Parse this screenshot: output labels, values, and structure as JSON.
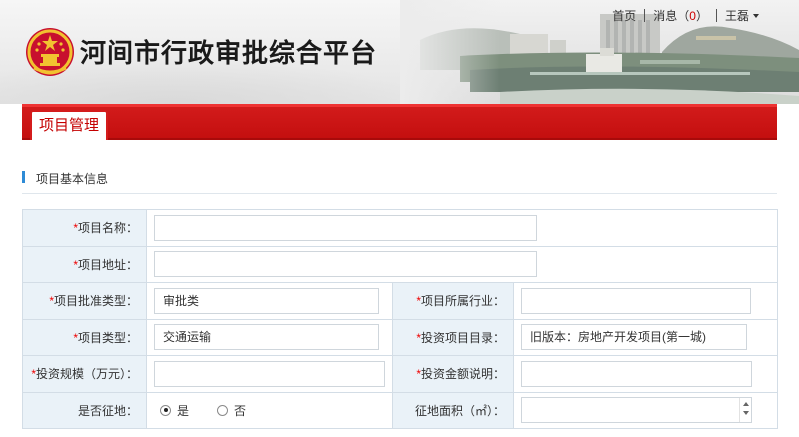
{
  "header": {
    "site_title": "河间市行政审批综合平台",
    "nav": {
      "home": "首页",
      "messages_label": "消息",
      "messages_open": "（",
      "messages_count": "0",
      "messages_close": "）",
      "user": "王磊"
    }
  },
  "tab": {
    "label": "项目管理"
  },
  "section": {
    "title": "项目基本信息"
  },
  "form": {
    "required_mark": "*",
    "project_name": {
      "label": "项目名称：",
      "value": ""
    },
    "project_address": {
      "label": "项目地址：",
      "value": ""
    },
    "approval_type": {
      "label": "项目批准类型：",
      "value": "审批类"
    },
    "industry": {
      "label": "项目所属行业：",
      "value": ""
    },
    "project_type": {
      "label": "项目类型：",
      "value": "交通运输"
    },
    "invest_catalog": {
      "label": "投资项目目录：",
      "value": "旧版本：房地产开发项目(第一城)"
    },
    "invest_scale": {
      "label": "投资规模（万元）：",
      "value": ""
    },
    "invest_note": {
      "label": "投资金额说明：",
      "value": ""
    },
    "land_acquisition": {
      "label": "是否征地：",
      "options": [
        "是",
        "否"
      ],
      "selected": "是"
    },
    "land_area": {
      "label": "征地面积（㎡）：",
      "value": ""
    }
  },
  "colors": {
    "brand_red": "#d41c1c",
    "label_bg": "#eaf2f8",
    "section_marker": "#2e8bd6"
  }
}
